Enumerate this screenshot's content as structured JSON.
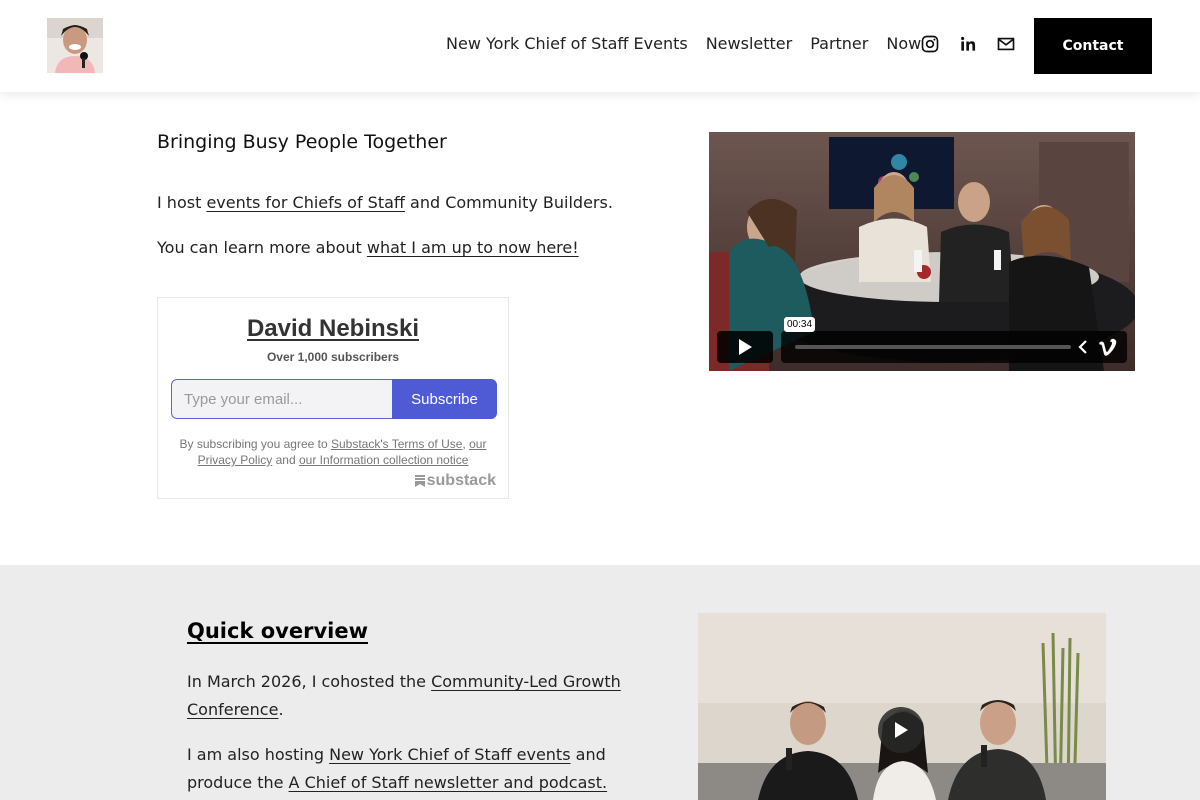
{
  "header": {
    "logo_alt": "David Nebinski avatar",
    "nav": [
      {
        "label": "New York Chief of Staff Events"
      },
      {
        "label": "Newsletter"
      },
      {
        "label": "Partner"
      },
      {
        "label": "Now"
      }
    ],
    "social_icons": [
      "instagram-icon",
      "linkedin-icon",
      "email-icon"
    ],
    "contact_label": "Contact"
  },
  "hero": {
    "headline": "Bringing Busy People Together",
    "p1_prefix": "I host ",
    "p1_link": "events for Chiefs of Staff",
    "p1_suffix": " and Community Builders.",
    "p2_prefix": "You can learn more about ",
    "p2_link": "what I am up to now here!"
  },
  "substack": {
    "name": "David Nebinski",
    "subscribers": "Over 1,000 subscribers",
    "email_placeholder": "Type your email...",
    "subscribe_label": "Subscribe",
    "legal_prefix": "By subscribing you agree to ",
    "terms_link": "Substack's Terms of Use",
    "sep1": ", ",
    "privacy_link_a": "our",
    "privacy_link_b": "Privacy Policy",
    "sep2": " and ",
    "info_link": "our Information collection notice",
    "brand": "substack"
  },
  "video1": {
    "time": "00:34"
  },
  "overview": {
    "title": "Quick overview",
    "p1_prefix": "In March 2026, I cohosted the ",
    "p1_link": "Community-Led Growth Conference",
    "p1_suffix": ".",
    "p2_prefix": "I am also hosting ",
    "p2_link1": "New York Chief of Staff events",
    "p2_mid": " and produce the ",
    "p2_link2": "A Chief of Staff newsletter and podcast."
  },
  "colors": {
    "accent": "#4f5bd5",
    "contact_bg": "#000000",
    "section_bg": "#ececec"
  }
}
